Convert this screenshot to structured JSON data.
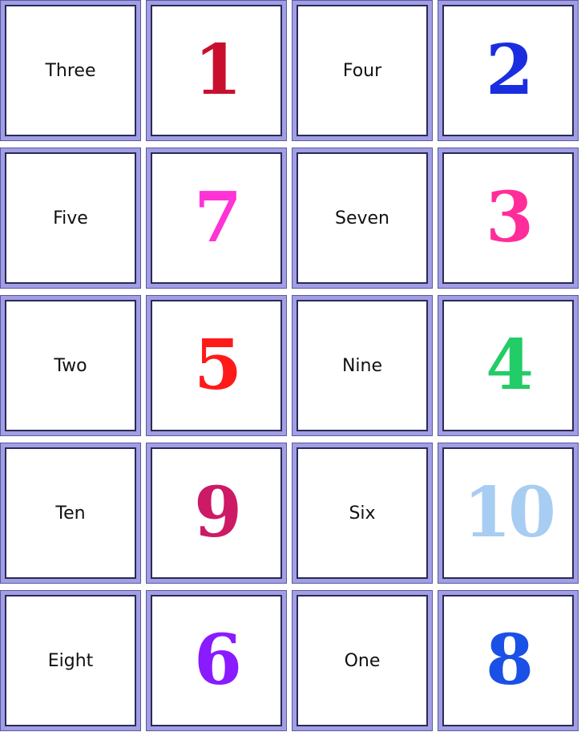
{
  "cards": [
    {
      "type": "word",
      "text": "Three"
    },
    {
      "type": "number",
      "text": "1",
      "color": "#c8102e"
    },
    {
      "type": "word",
      "text": "Four"
    },
    {
      "type": "number",
      "text": "2",
      "color": "#1a2ee0"
    },
    {
      "type": "word",
      "text": "Five"
    },
    {
      "type": "number",
      "text": "7",
      "color": "#ff33d6"
    },
    {
      "type": "word",
      "text": "Seven"
    },
    {
      "type": "number",
      "text": "3",
      "color": "#ff2d9a"
    },
    {
      "type": "word",
      "text": "Two"
    },
    {
      "type": "number",
      "text": "5",
      "color": "#ff1a1a"
    },
    {
      "type": "word",
      "text": "Nine"
    },
    {
      "type": "number",
      "text": "4",
      "color": "#22cc66"
    },
    {
      "type": "word",
      "text": "Ten"
    },
    {
      "type": "number",
      "text": "9",
      "color": "#cc1a66"
    },
    {
      "type": "word",
      "text": "Six"
    },
    {
      "type": "number",
      "text": "10",
      "color": "#a8cdf2"
    },
    {
      "type": "word",
      "text": "Eight"
    },
    {
      "type": "number",
      "text": "6",
      "color": "#8a1aff"
    },
    {
      "type": "word",
      "text": "One"
    },
    {
      "type": "number",
      "text": "8",
      "color": "#1a50e6"
    }
  ]
}
